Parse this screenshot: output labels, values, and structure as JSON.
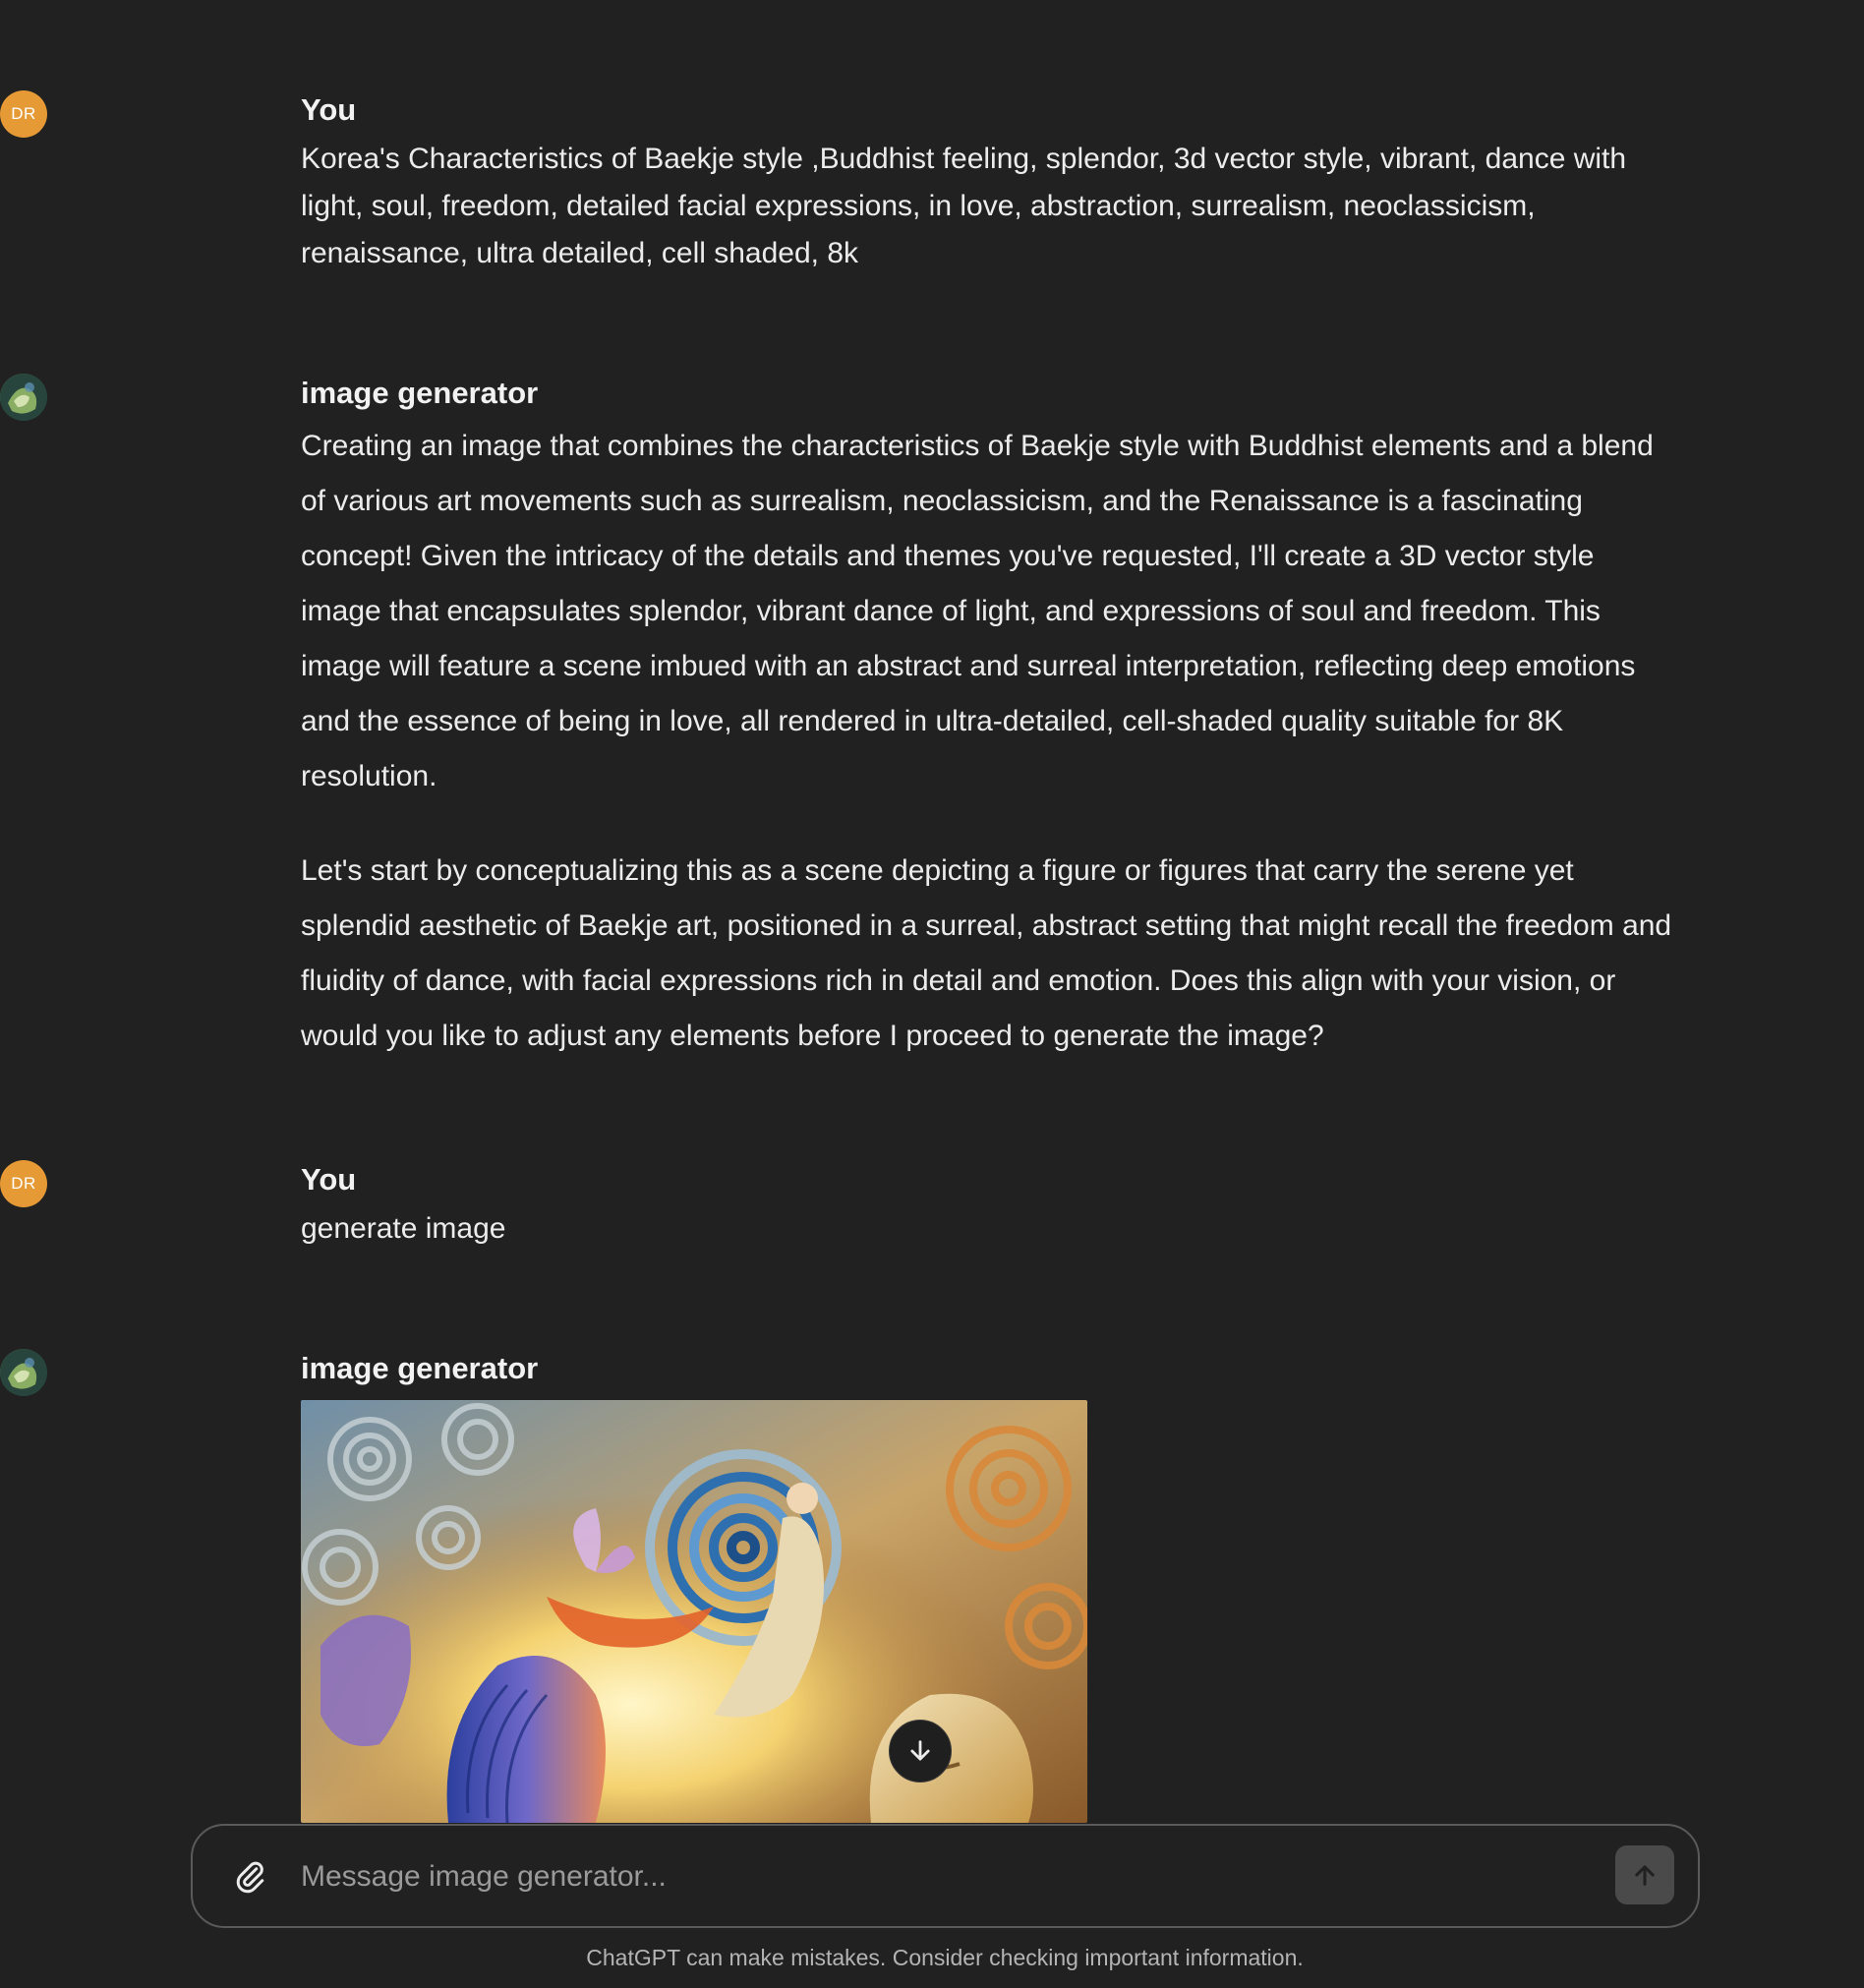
{
  "messages": [
    {
      "author": "You",
      "avatar_initials": "DR",
      "text": "Korea's Characteristics of Baekje style ,Buddhist feeling, splendor, 3d vector style, vibrant, dance with light, soul, freedom, detailed facial expressions, in love, abstraction, surrealism, neoclassicism, renaissance, ultra detailed, cell shaded, 8k"
    },
    {
      "author": "image generator",
      "paragraphs": [
        "Creating an image that combines the characteristics of Baekje style with Buddhist elements and a blend of various art movements such as surrealism, neoclassicism, and the Renaissance is a fascinating concept! Given the intricacy of the details and themes you've requested, I'll create a 3D vector style image that encapsulates splendor, vibrant dance of light, and expressions of soul and freedom. This image will feature a scene imbued with an abstract and surreal interpretation, reflecting deep emotions and the essence of being in love, all rendered in ultra-detailed, cell-shaded quality suitable for 8K resolution.",
        "Let's start by conceptualizing this as a scene depicting a figure or figures that carry the serene yet splendid aesthetic of Baekje art, positioned in a surreal, abstract setting that might recall the freedom and fluidity of dance, with facial expressions rich in detail and emotion. Does this align with your vision, or would you like to adjust any elements before I proceed to generate the image?"
      ]
    },
    {
      "author": "You",
      "avatar_initials": "DR",
      "text": "generate image"
    },
    {
      "author": "image generator"
    }
  ],
  "composer": {
    "placeholder": "Message image generator..."
  },
  "icons": {
    "attach": "paperclip-icon",
    "send": "arrow-up-icon",
    "scroll": "arrow-down-icon"
  },
  "disclaimer": "ChatGPT can make mistakes. Consider checking important information.",
  "colors": {
    "background": "#212121",
    "user_avatar": "#e69a36",
    "text": "#ececec"
  }
}
